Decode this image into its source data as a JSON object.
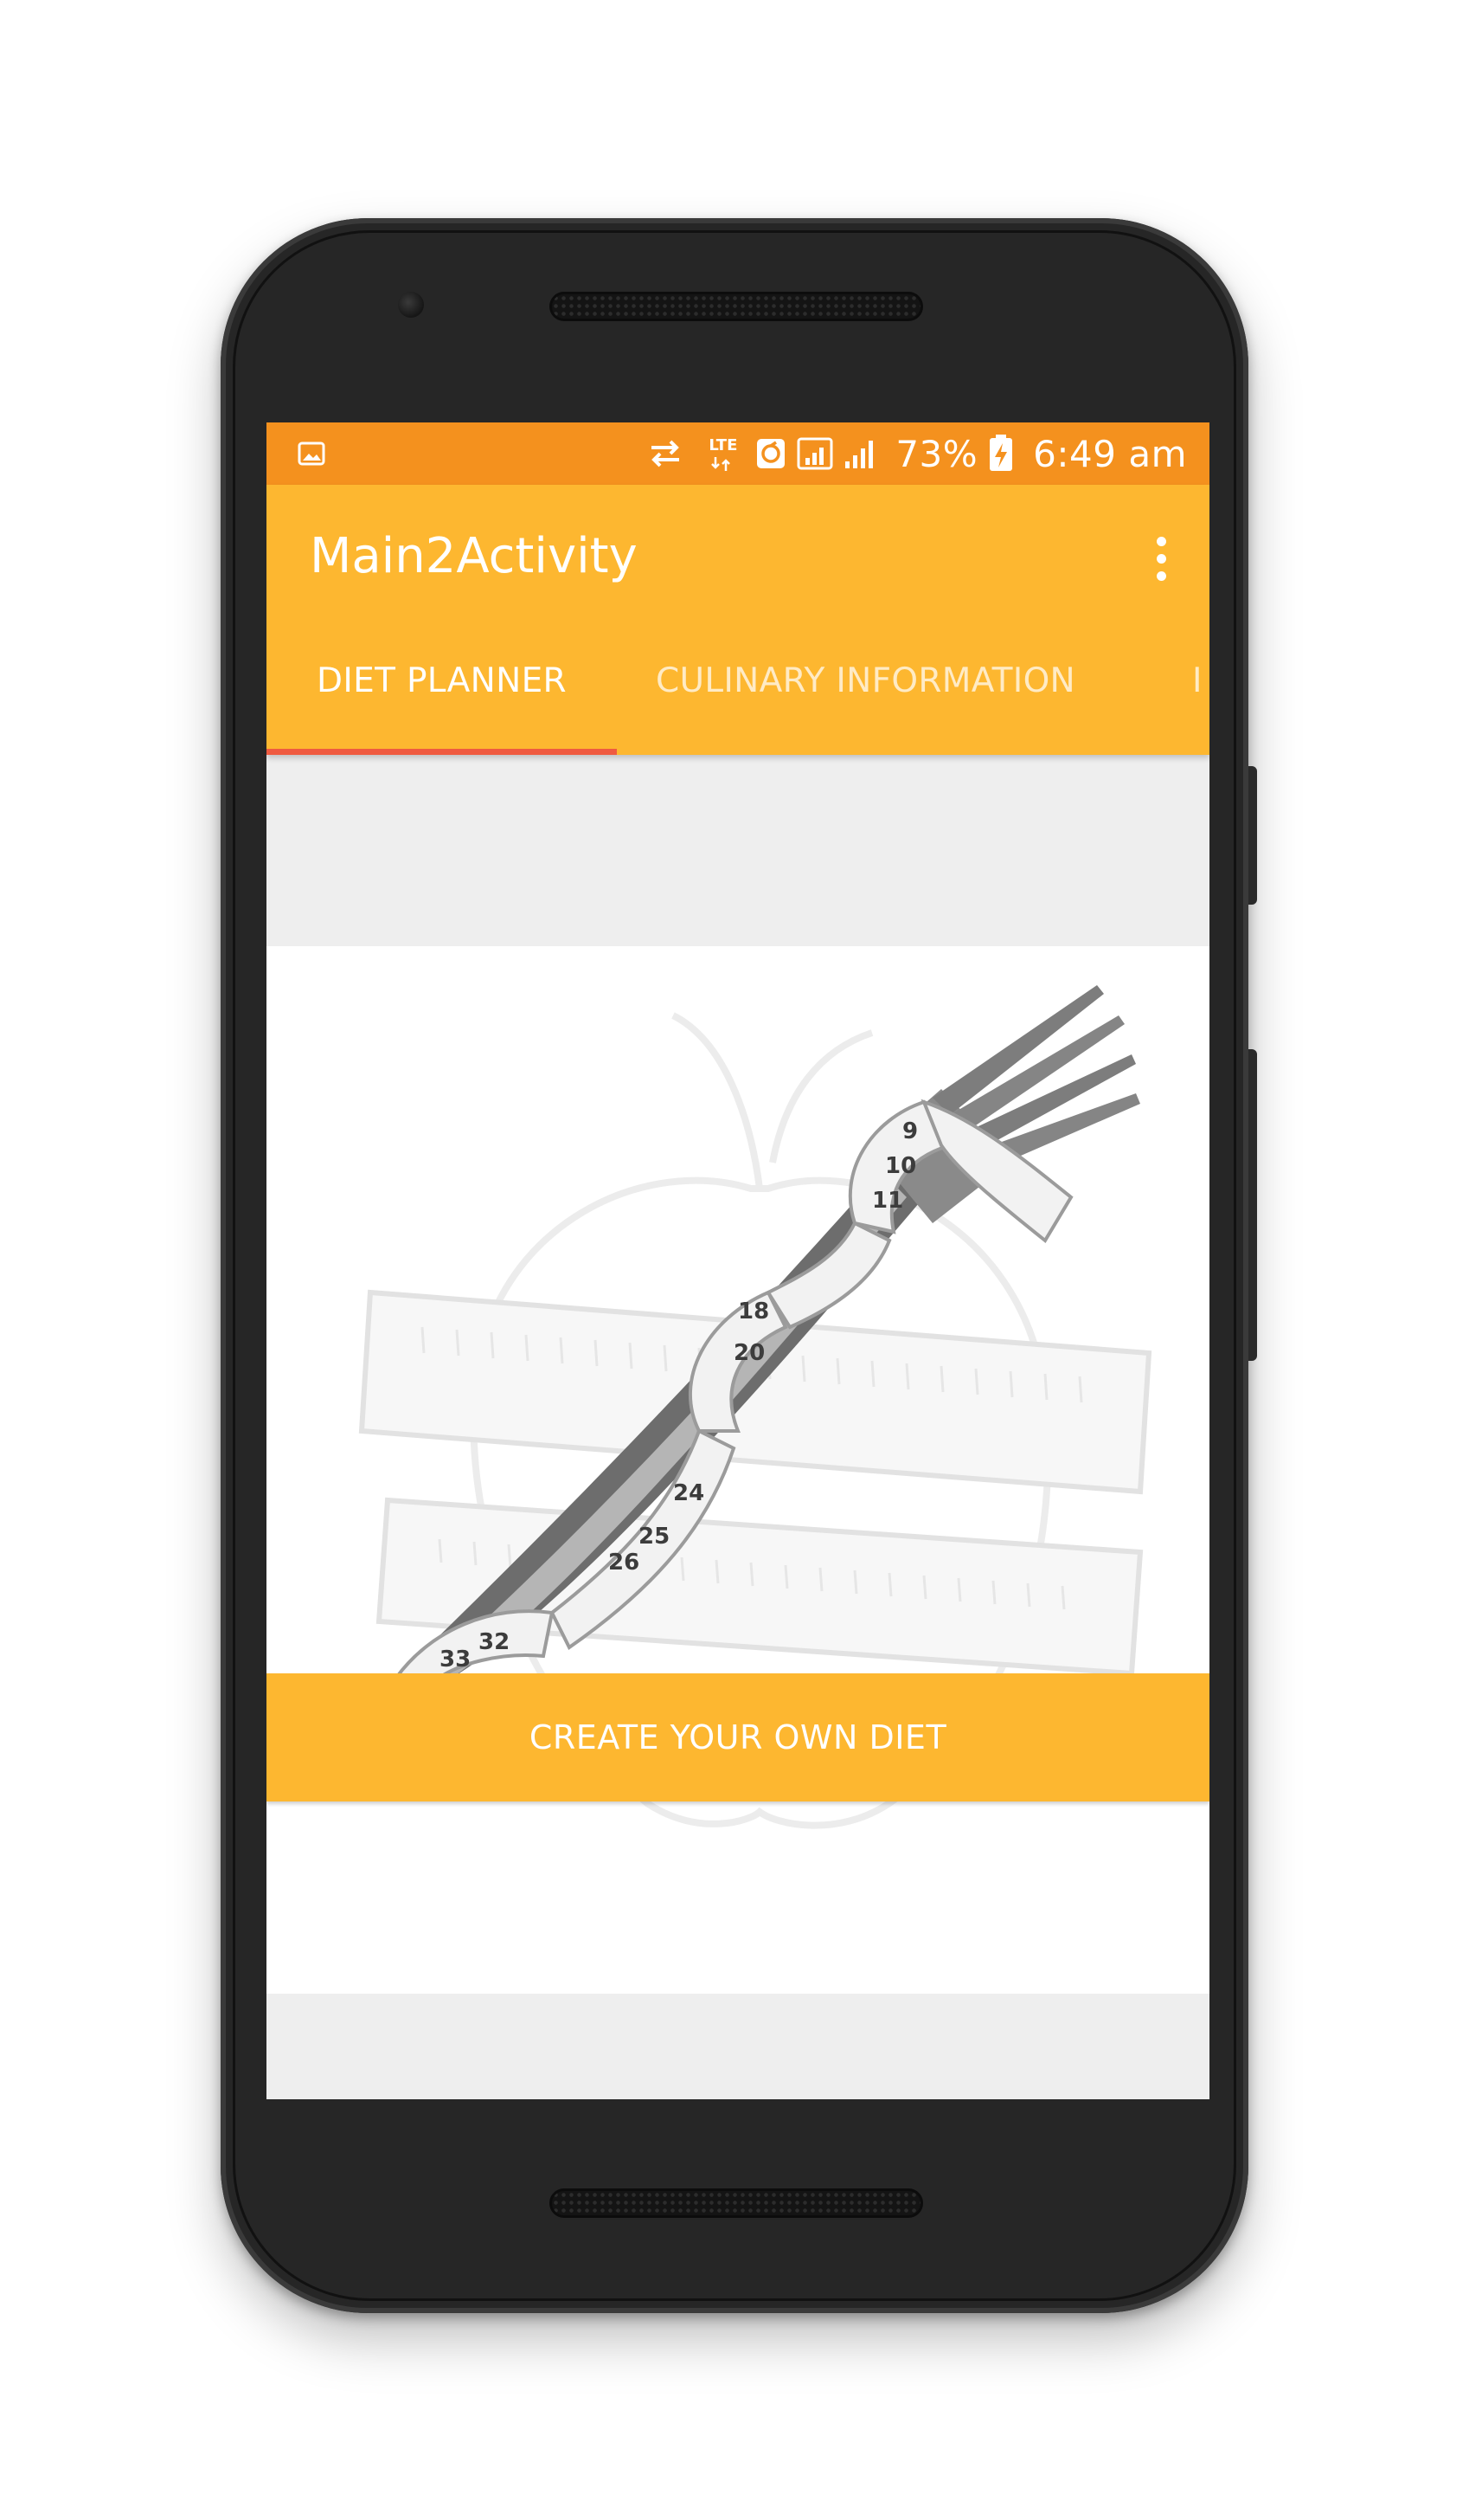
{
  "status_bar": {
    "battery": "73%",
    "time": "6:49 am",
    "network_label": "LTE",
    "icons": [
      "image-icon",
      "data-transfer-icon",
      "lte-icon",
      "sync-icon",
      "signal-icon",
      "signal-icon",
      "battery-charging-icon"
    ]
  },
  "app_bar": {
    "title": "Main2Activity",
    "overflow_icon": "more-vert-icon"
  },
  "tabs": [
    {
      "label": "DIET PLANNER",
      "active": true
    },
    {
      "label": "CULINARY INFORMATION",
      "active": false
    },
    {
      "label": "I",
      "active": false
    }
  ],
  "main": {
    "image_icon": "fork-measuring-tape-illustration",
    "button_label": "CREATE YOUR OWN DIET"
  },
  "colors": {
    "status_bar": "#f4911e",
    "primary": "#fdb730",
    "tab_indicator": "#ef5a40",
    "background": "#eeeeee"
  }
}
